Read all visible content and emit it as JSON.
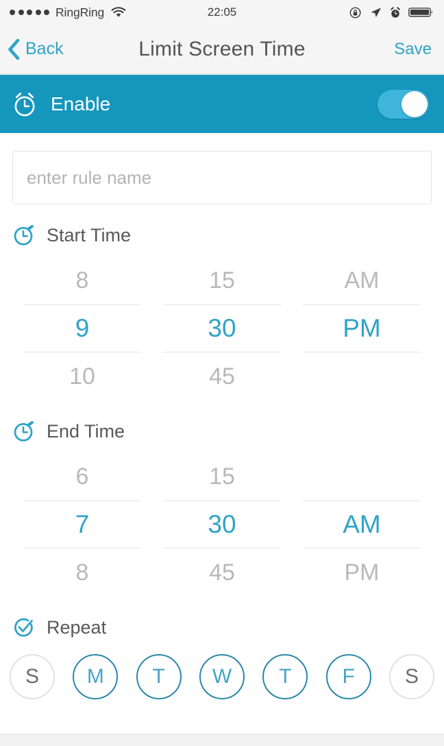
{
  "status_bar": {
    "signal_dots": 5,
    "carrier": "RingRing",
    "wifi_icon": "wifi-icon",
    "time": "22:05",
    "right_icons": [
      "rotation-lock-icon",
      "location-arrow-icon",
      "alarm-clock-icon",
      "battery-icon"
    ]
  },
  "nav_bar": {
    "back_label": "Back",
    "back_icon": "chevron-left-icon",
    "title": "Limit Screen Time",
    "save_label": "Save"
  },
  "enable": {
    "icon": "alarm-clock-icon",
    "label": "Enable",
    "toggle_on": true,
    "bar_color": "#1596bd",
    "toggle_track_color": "#3fb5dc",
    "toggle_knob_color": "#ffffff"
  },
  "rule_name": {
    "value": "",
    "placeholder": "enter rule name"
  },
  "start_time": {
    "icon": "stopwatch-icon",
    "label": "Start Time",
    "hour": {
      "above": "8",
      "selected": "9",
      "below": "10"
    },
    "minute": {
      "above": "15",
      "selected": "30",
      "below": "45"
    },
    "meridiem": {
      "above": "AM",
      "selected": "PM",
      "below": ""
    }
  },
  "end_time": {
    "icon": "stopwatch-icon",
    "label": "End Time",
    "hour": {
      "above": "6",
      "selected": "7",
      "below": "8"
    },
    "minute": {
      "above": "15",
      "selected": "30",
      "below": "45"
    },
    "meridiem": {
      "above": "",
      "selected": "AM",
      "below": "PM"
    }
  },
  "repeat": {
    "icon": "check-circle-icon",
    "label": "Repeat",
    "days": [
      {
        "label": "S",
        "name": "sunday",
        "selected": false
      },
      {
        "label": "M",
        "name": "monday",
        "selected": true
      },
      {
        "label": "T",
        "name": "tuesday",
        "selected": true
      },
      {
        "label": "W",
        "name": "wednesday",
        "selected": true
      },
      {
        "label": "T",
        "name": "thursday",
        "selected": true
      },
      {
        "label": "F",
        "name": "friday",
        "selected": true
      },
      {
        "label": "S",
        "name": "saturday",
        "selected": false
      }
    ]
  },
  "theme": {
    "accent": "#2fa3c8",
    "accent_dark": "#1596bd",
    "muted_text": "#b9b9bb",
    "label_text": "#585858",
    "day_selected_border": "#2c87ab"
  }
}
